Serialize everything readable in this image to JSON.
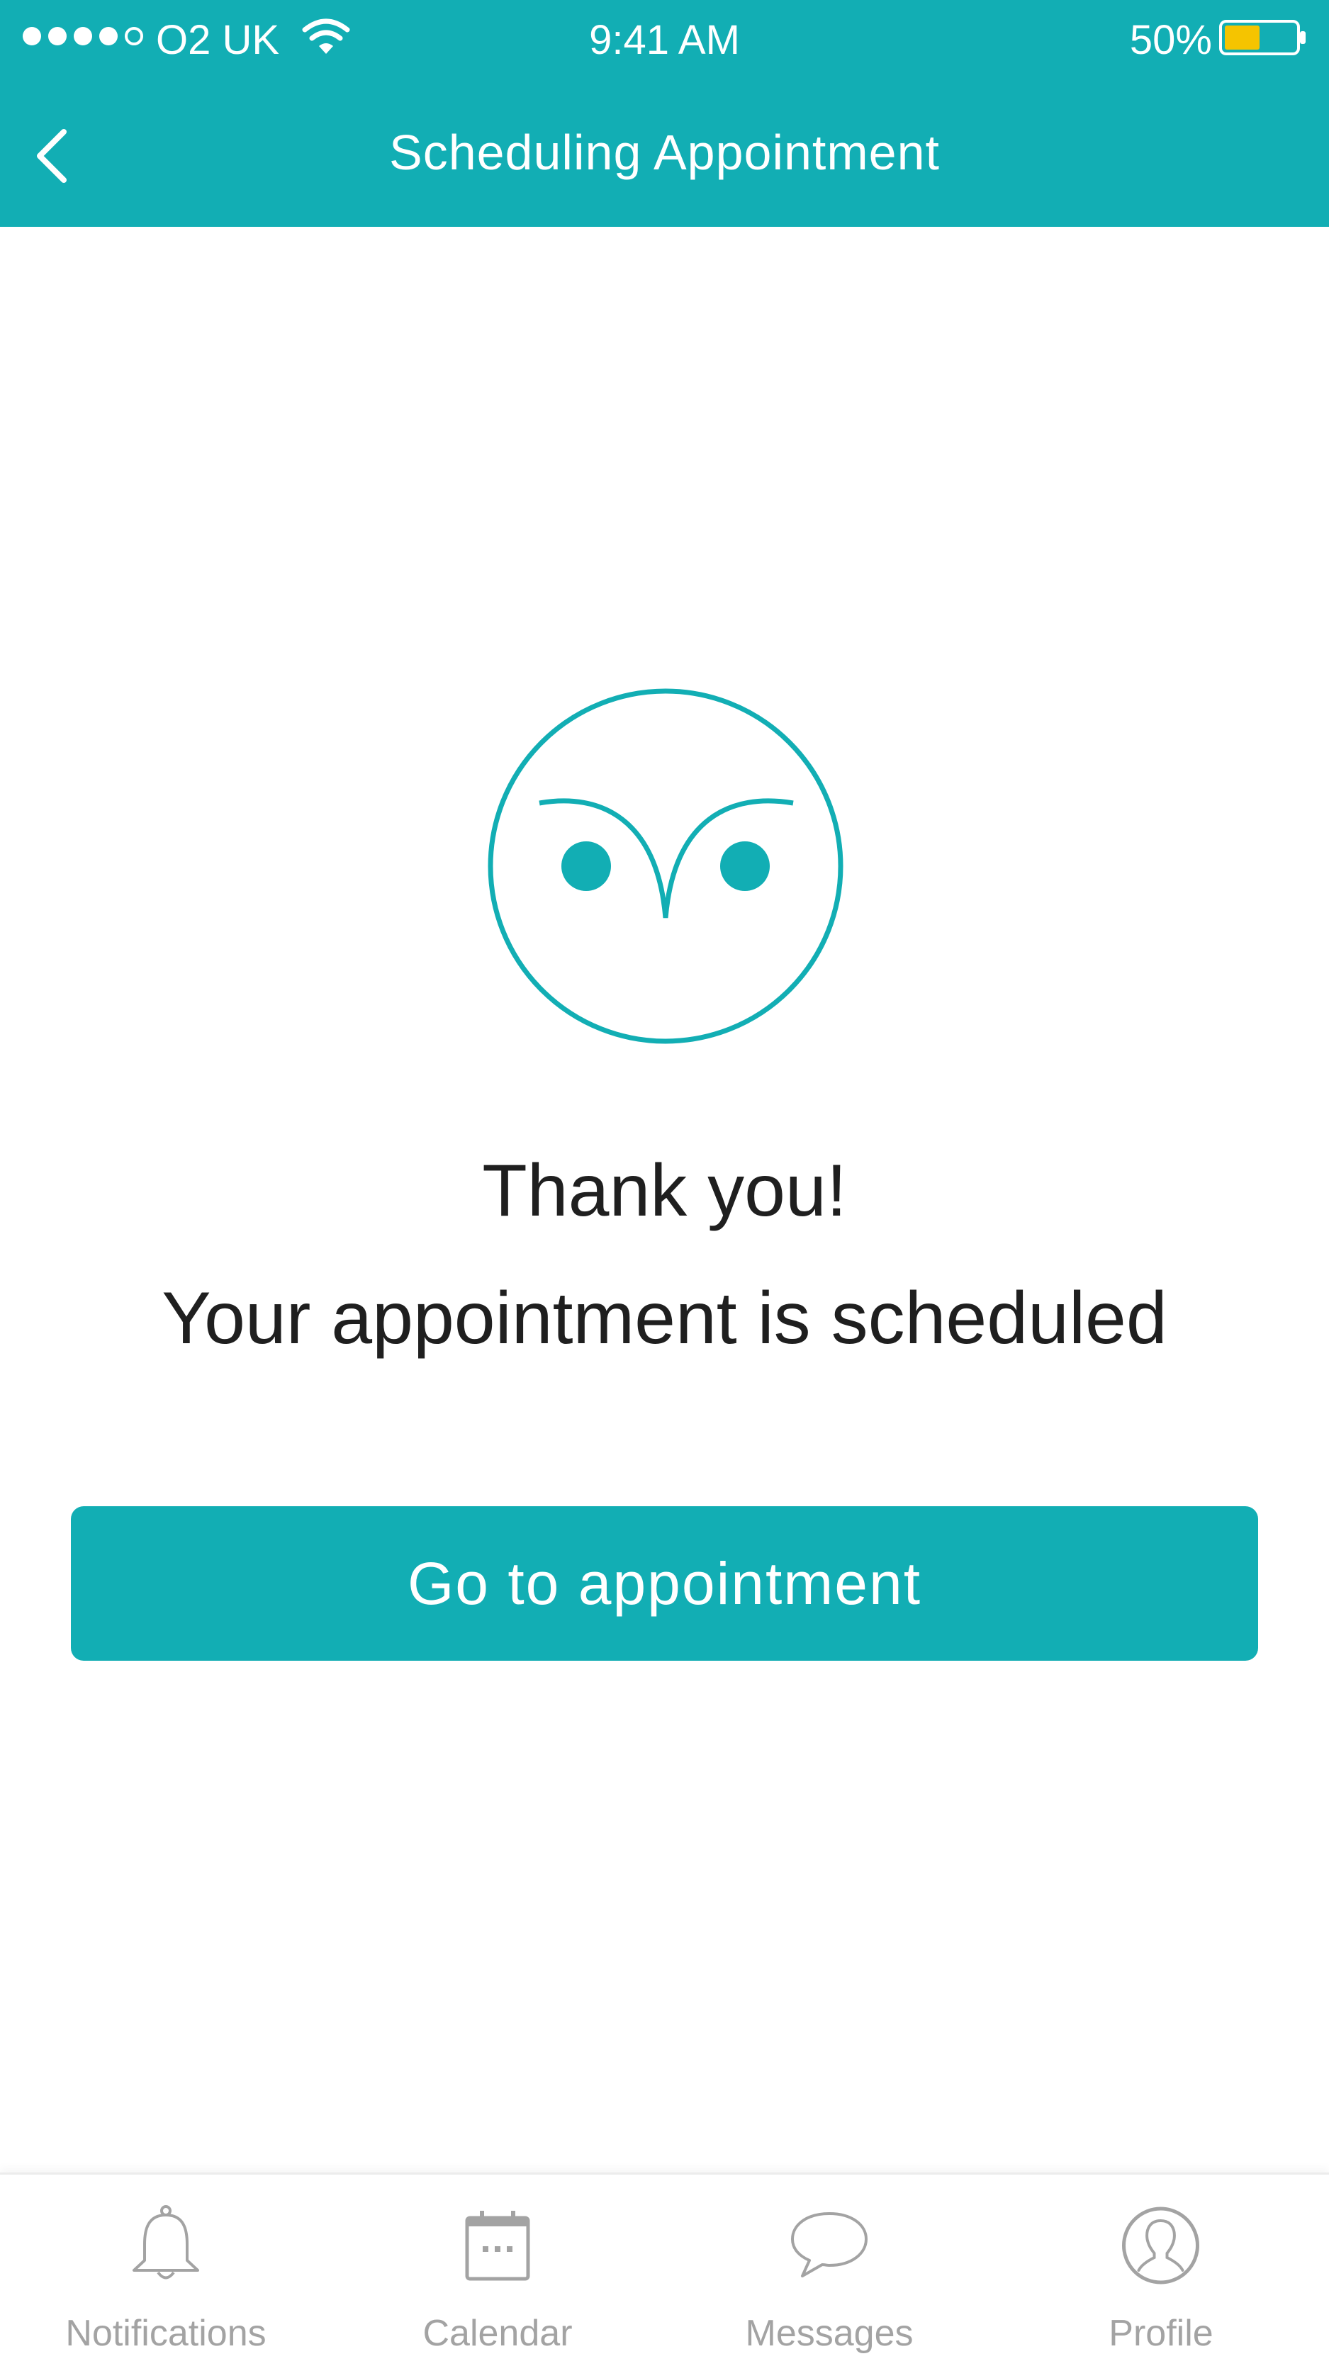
{
  "status_bar": {
    "carrier": "O2 UK",
    "time": "9:41 AM",
    "battery": "50%",
    "signal_bars_filled": 4,
    "signal_bars_total": 5,
    "battery_level": 0.5,
    "battery_color": "#f5c400"
  },
  "header": {
    "title": "Scheduling Appointment",
    "back_icon": "chevron-left-icon"
  },
  "confirmation": {
    "icon": "owl-face-icon",
    "title": "Thank you!",
    "message": "Your appointment is scheduled"
  },
  "cta": {
    "label": "Go to appointment"
  },
  "tab_bar": {
    "items": [
      {
        "label": "Notifications",
        "icon": "bell-icon"
      },
      {
        "label": "Calendar",
        "icon": "calendar-icon"
      },
      {
        "label": "Messages",
        "icon": "chat-bubble-icon"
      },
      {
        "label": "Profile",
        "icon": "user-icon"
      }
    ]
  },
  "colors": {
    "accent": "#12aeb4",
    "text": "#1f1f1f",
    "tab_inactive": "#a3a3a3"
  }
}
